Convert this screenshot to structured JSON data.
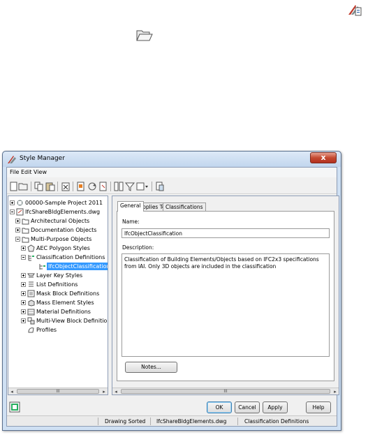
{
  "floating_icons": {
    "top_right": "folder-properties-icon",
    "folder": "open-folder-icon"
  },
  "window": {
    "title": "Style Manager",
    "close_glyph": "x"
  },
  "menu": [
    "File",
    "Edit",
    "View"
  ],
  "tree": {
    "items": [
      {
        "label": "00000-Sample Project 2011",
        "icon": "project-icon"
      },
      {
        "label": "IfcShareBldgElements.dwg",
        "icon": "drawing-icon"
      },
      {
        "label": "Architectural Objects",
        "icon": "folder-icon"
      },
      {
        "label": "Documentation Objects",
        "icon": "folder-icon"
      },
      {
        "label": "Multi-Purpose Objects",
        "icon": "folder-icon"
      },
      {
        "label": "AEC Polygon Styles",
        "icon": "polygon-icon"
      },
      {
        "label": "Classification Definitions",
        "icon": "classification-icon"
      },
      {
        "label": "IfcObjectClassification",
        "icon": "classification-item-icon"
      },
      {
        "label": "Layer Key Styles",
        "icon": "layer-key-icon"
      },
      {
        "label": "List Definitions",
        "icon": "list-icon"
      },
      {
        "label": "Mask Block Definitions",
        "icon": "mask-block-icon"
      },
      {
        "label": "Mass Element Styles",
        "icon": "mass-element-icon"
      },
      {
        "label": "Material Definitions",
        "icon": "material-icon"
      },
      {
        "label": "Multi-View Block Definitions",
        "icon": "multiview-block-icon"
      },
      {
        "label": "Profiles",
        "icon": "profile-icon"
      }
    ]
  },
  "tabs": [
    "General",
    "Applies To",
    "Classifications"
  ],
  "general": {
    "name_label": "Name:",
    "name_value": "IfcObjectClassification",
    "description_label": "Description:",
    "description_value": "Classification of Building Elements/Objects based on IFC2x3 specifications from IAI. Only 3D objects are included in the classification",
    "notes_button": "Notes..."
  },
  "buttons": {
    "ok": "OK",
    "cancel": "Cancel",
    "apply": "Apply",
    "help": "Help"
  },
  "scroll_thumb_glyph": "III",
  "status": {
    "left": "Drawing Sorted",
    "middle": "IfcShareBldgElements.dwg",
    "right": "Classification Definitions"
  }
}
